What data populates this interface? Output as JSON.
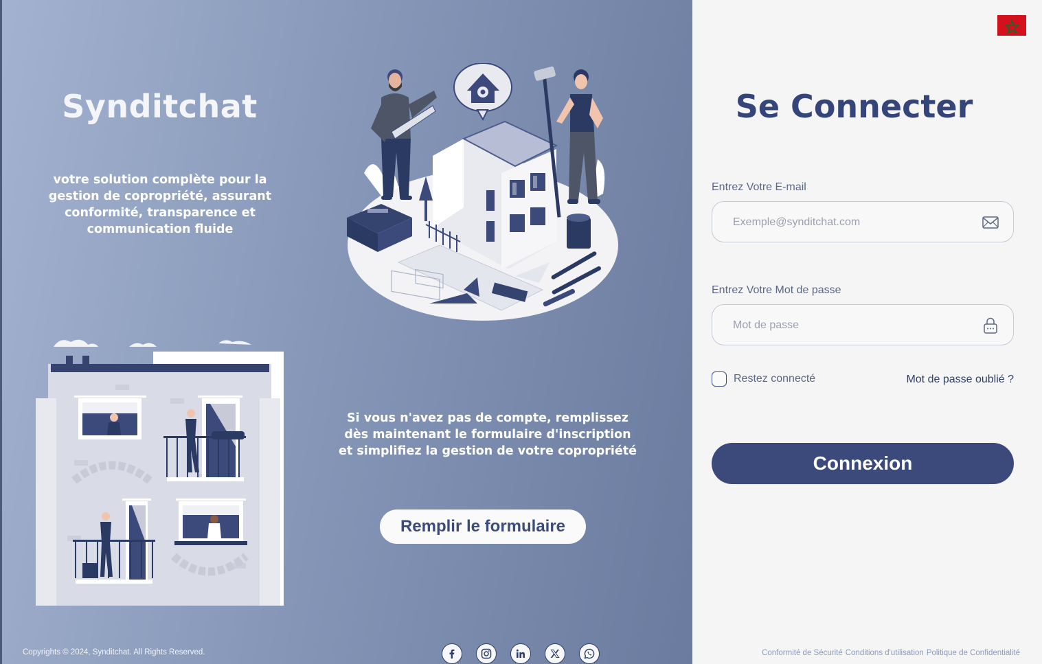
{
  "app": {
    "name": "Synditchat",
    "tagline": "votre solution complète pour la gestion de copropriété, assurant conformité, transparence et communication fluide"
  },
  "signup": {
    "text": "Si vous n'avez pas de compte, remplissez dès maintenant le formulaire d'inscription et simplifiez la gestion de votre copropriété",
    "button_label": "Remplir le formulaire"
  },
  "footer": {
    "copyright": "Copyrights © 2024, Synditchat. All Rights Reserved.",
    "links": [
      "Conformité de Sécurité",
      "Conditions d'utilisation",
      "Politique de Confidentialité"
    ]
  },
  "social": [
    "facebook-icon",
    "instagram-icon",
    "linkedin-icon",
    "x-icon",
    "whatsapp-icon"
  ],
  "language": {
    "flag": "morocco-flag-icon"
  },
  "login": {
    "title": "Se Connecter",
    "email_label": "Entrez Votre E-mail",
    "email_placeholder": "Exemple@synditchat.com",
    "email_icon": "envelope-icon",
    "password_label": "Entrez Votre Mot de passe",
    "password_placeholder": "Mot de passe",
    "password_icon": "lock-icon",
    "remember_label": "Restez connecté",
    "forgot_label": "Mot de passe oublié ?",
    "submit_label": "Connexion"
  },
  "colors": {
    "primary": "#3b4a7b",
    "panel_start": "#a3b2cf",
    "panel_end": "#6a7b9f",
    "background": "#f5f5f6"
  }
}
